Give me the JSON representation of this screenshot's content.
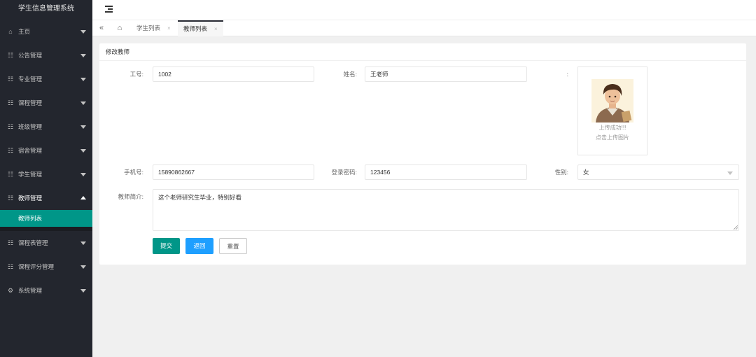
{
  "app": {
    "title": "学生信息管理系统"
  },
  "sidebar": {
    "items": [
      {
        "label": "主页",
        "icon": "home-icon",
        "glyph": "⌂"
      },
      {
        "label": "公告管理",
        "icon": "menu-icon",
        "glyph": "☷"
      },
      {
        "label": "专业管理",
        "icon": "menu-icon",
        "glyph": "☷"
      },
      {
        "label": "课程管理",
        "icon": "menu-icon",
        "glyph": "☷"
      },
      {
        "label": "班级管理",
        "icon": "menu-icon",
        "glyph": "☷"
      },
      {
        "label": "宿舍管理",
        "icon": "menu-icon",
        "glyph": "☷"
      },
      {
        "label": "学生管理",
        "icon": "menu-icon",
        "glyph": "☷"
      },
      {
        "label": "教师管理",
        "icon": "menu-icon",
        "glyph": "☷"
      },
      {
        "label": "课程表管理",
        "icon": "menu-icon",
        "glyph": "☷"
      },
      {
        "label": "课程评分管理",
        "icon": "menu-icon",
        "glyph": "☷"
      },
      {
        "label": "系统管理",
        "icon": "gear-icon",
        "glyph": "⚙"
      }
    ],
    "open_sub": {
      "label": "教师列表"
    }
  },
  "tabs": {
    "back_glyph": "«",
    "home_glyph": "⌂",
    "close_glyph": "×",
    "items": [
      {
        "label": "学生列表"
      },
      {
        "label": "教师列表"
      }
    ]
  },
  "form": {
    "title": "修改教师",
    "fields": {
      "job_no": {
        "label": "工号:",
        "value": "1002"
      },
      "name": {
        "label": "姓名:",
        "value": "王老师"
      },
      "avatar": {
        "label": ":",
        "status": "上传成功!!!",
        "hint": "点击上传图片"
      },
      "phone": {
        "label": "手机号:",
        "value": "15890862667"
      },
      "password": {
        "label": "登录密码:",
        "value": "123456"
      },
      "gender": {
        "label": "性别:",
        "value": "女"
      },
      "intro": {
        "label": "教师简介:",
        "value": "这个老师研究生毕业，特别好看"
      }
    },
    "buttons": {
      "submit": "提交",
      "back": "返回",
      "reset": "重置"
    }
  },
  "colors": {
    "sidebar_bg": "#23262e",
    "accent": "#009688",
    "blue": "#1e9fff"
  }
}
